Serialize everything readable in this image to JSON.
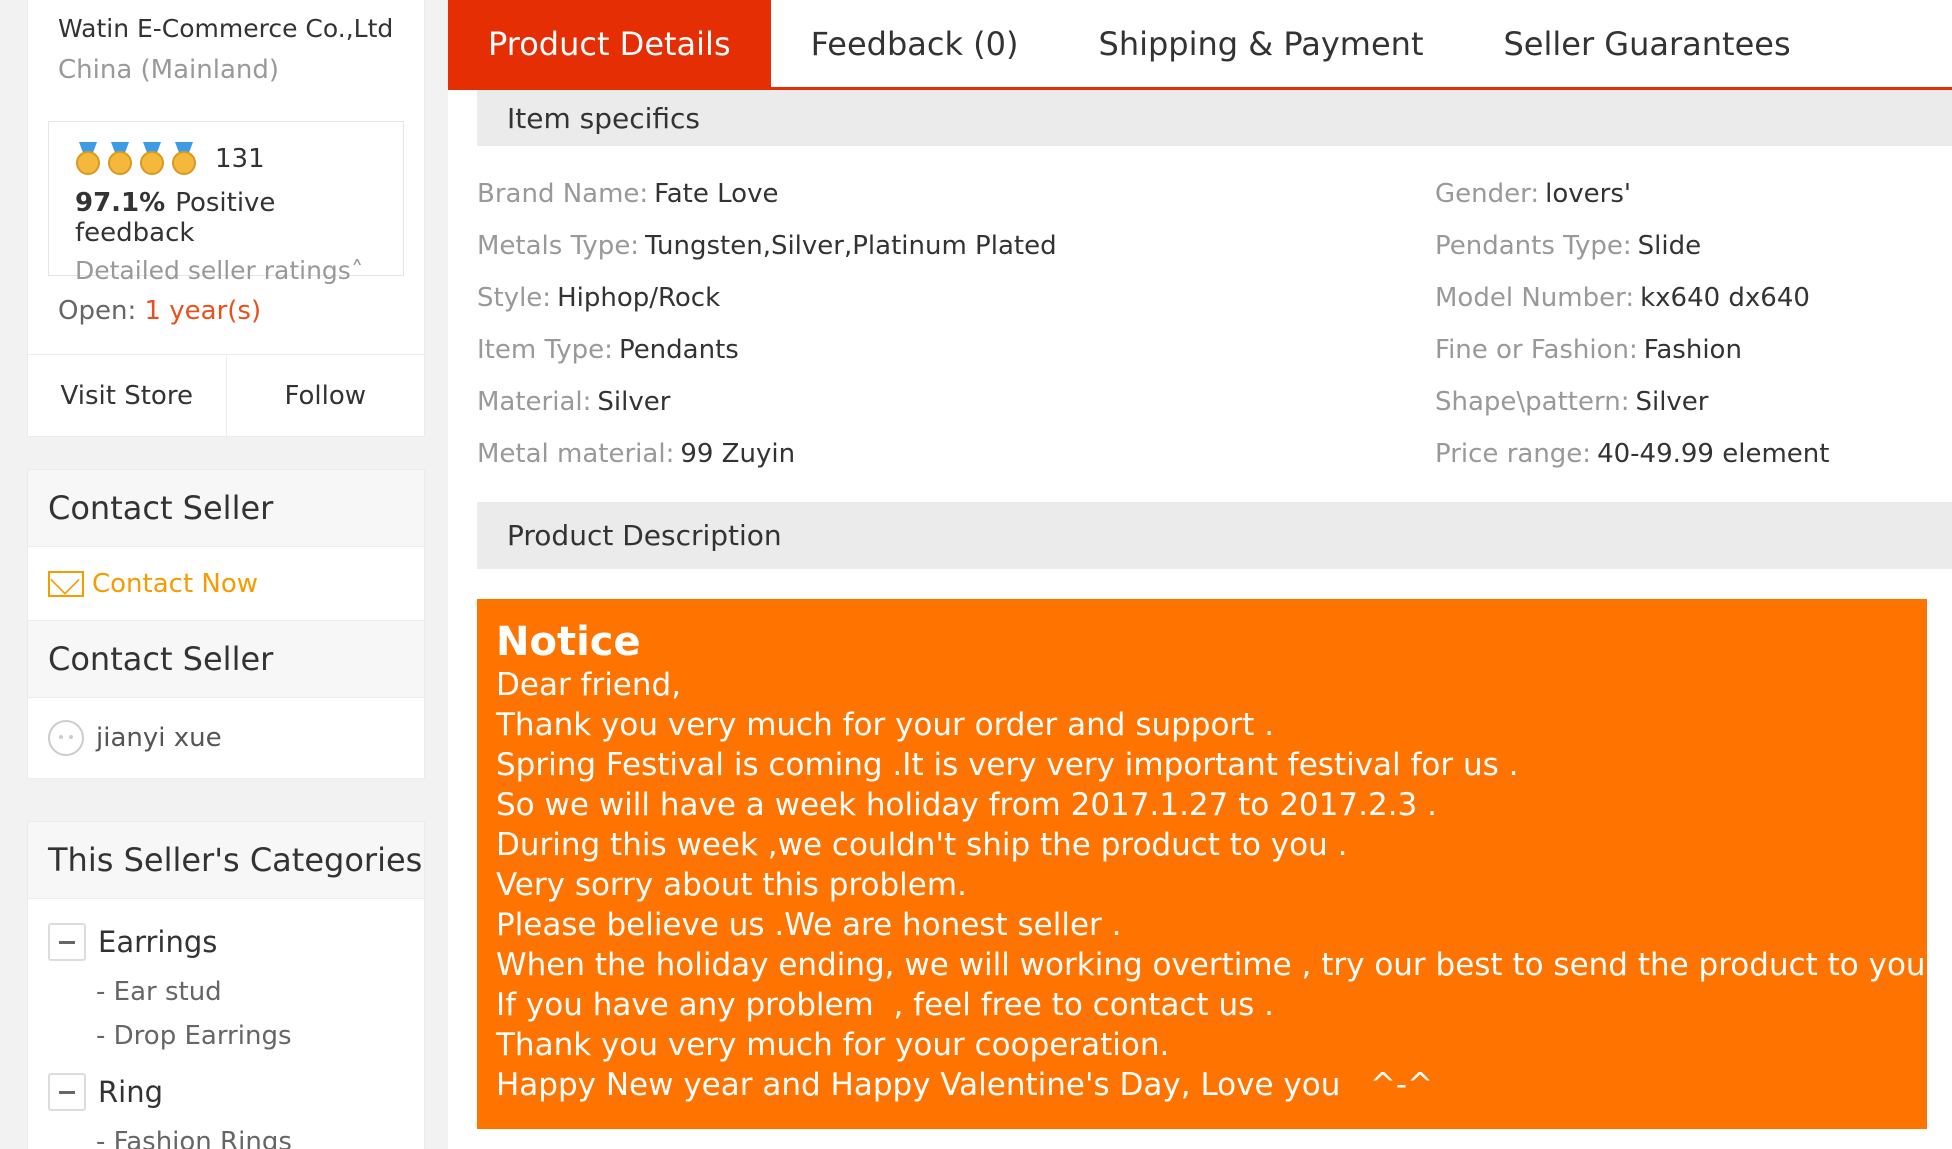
{
  "store": {
    "name": "Watin E-Commerce Co.,Ltd",
    "location": "China (Mainland)",
    "rating_count": "131",
    "positive_pct": "97.1%",
    "positive_label": "Positive feedback",
    "detailed_ratings": "Detailed seller ratings",
    "open_label": "Open:",
    "open_value": "1 year(s)",
    "visit_store": "Visit Store",
    "follow": "Follow"
  },
  "contact": {
    "heading1": "Contact Seller",
    "contact_now": "Contact Now",
    "heading2": "Contact Seller",
    "person": "jianyi xue"
  },
  "categories": {
    "heading": "This Seller's Categories",
    "groups": [
      {
        "label": "Earrings",
        "subs": [
          "- Ear stud",
          "- Drop Earrings"
        ]
      },
      {
        "label": "Ring",
        "subs": [
          "- Fashion Rings"
        ]
      }
    ]
  },
  "tabs": [
    "Product Details",
    "Feedback (0)",
    "Shipping & Payment",
    "Seller Guarantees"
  ],
  "item_specifics": {
    "heading": "Item specifics",
    "items": [
      {
        "label": "Brand Name:",
        "value": "Fate Love"
      },
      {
        "label": "Gender:",
        "value": "lovers'"
      },
      {
        "label": "Metals Type:",
        "value": "Tungsten,Silver,Platinum Plated"
      },
      {
        "label": "Pendants Type:",
        "value": "Slide"
      },
      {
        "label": "Style:",
        "value": "Hiphop/Rock"
      },
      {
        "label": "Model Number:",
        "value": "kx640 dx640"
      },
      {
        "label": "Item Type:",
        "value": "Pendants"
      },
      {
        "label": "Fine or Fashion:",
        "value": "Fashion"
      },
      {
        "label": "Material:",
        "value": "Silver"
      },
      {
        "label": "Shape\\pattern:",
        "value": "Silver"
      },
      {
        "label": "Metal material:",
        "value": "99 Zuyin"
      },
      {
        "label": "Price range:",
        "value": "40-49.99 element"
      }
    ]
  },
  "description": {
    "heading": "Product Description",
    "notice_title": "Notice",
    "lines": [
      "Dear friend,",
      "Thank you very much for your order and support .",
      "Spring Festival is coming .It is very very important festival for us .",
      "So we will have a week holiday from 2017.1.27 to 2017.2.3 .",
      "During this week ,we couldn't ship the product to you .",
      "Very sorry about this problem.",
      "Please believe us .We are honest seller .",
      "When the holiday ending, we will working overtime , try our best to send the product to you .",
      "If you have any problem  , feel free to contact us .",
      "Thank you very much for your cooperation.",
      "Happy New year and Happy Valentine's Day, Love you   ^-^"
    ]
  },
  "colors": {
    "accent": "#e62e04",
    "notice_bg": "#ff7300",
    "link_orange": "#f59c00"
  }
}
